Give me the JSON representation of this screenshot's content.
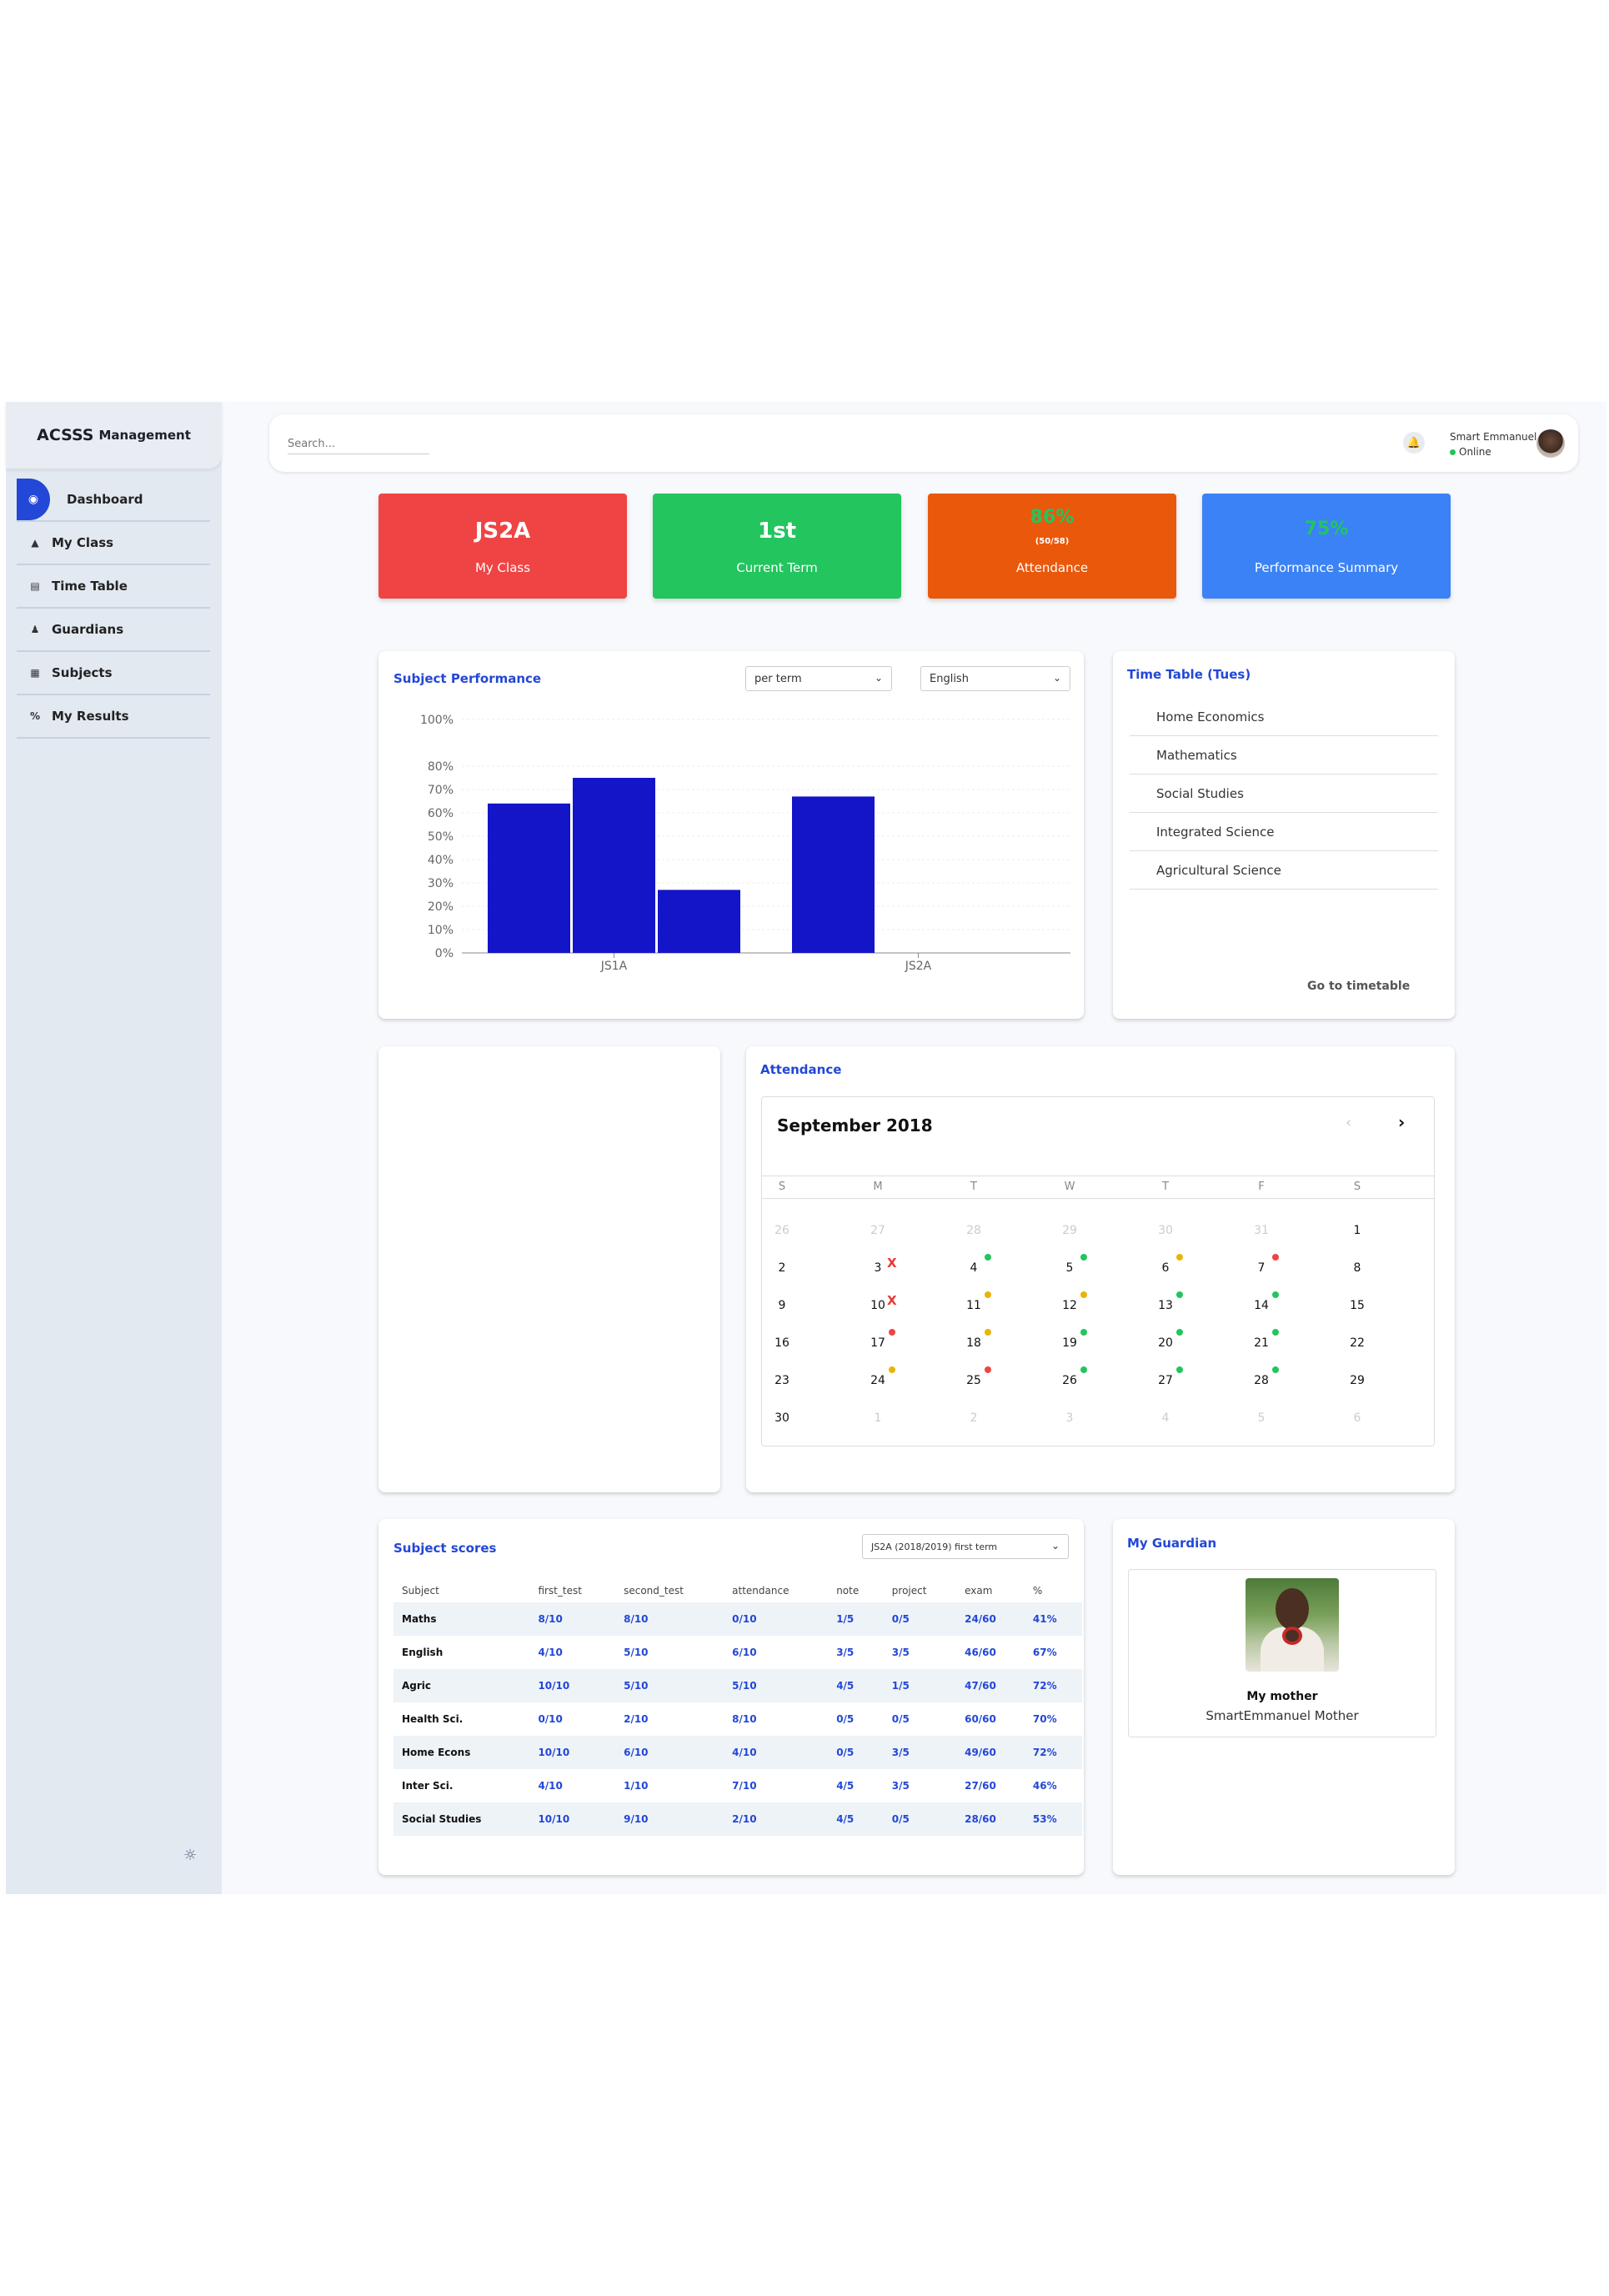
{
  "brand": {
    "name": "ACSSS",
    "suffix": "Management"
  },
  "sidebar": {
    "items": [
      {
        "label": "Dashboard",
        "icon": "dashboard-icon"
      },
      {
        "label": "My Class",
        "icon": "home-icon"
      },
      {
        "label": "Time Table",
        "icon": "table-icon"
      },
      {
        "label": "Guardians",
        "icon": "people-icon"
      },
      {
        "label": "Subjects",
        "icon": "book-icon"
      },
      {
        "label": "My Results",
        "icon": "percent-icon"
      }
    ],
    "theme_toggle_icon": "sun-icon"
  },
  "header": {
    "search_placeholder": "Search...",
    "user_name": "Smart Emmanuel",
    "user_status": "Online"
  },
  "stats": [
    {
      "value": "JS2A",
      "label": "My Class",
      "color": "#ef4444"
    },
    {
      "value": "1st",
      "label": "Current Term",
      "color": "#22c55e"
    },
    {
      "value": "86%",
      "detail": "(50/58)",
      "label": "Attendance",
      "color": "#ea580c"
    },
    {
      "value": "75%",
      "label": "Performance Summary",
      "color": "#3b82f6"
    }
  ],
  "subject_performance": {
    "title": "Subject Performance",
    "period_select": "per term",
    "subject_select": "English"
  },
  "chart_data": {
    "type": "bar",
    "categories": [
      "JS1A",
      "JS2A"
    ],
    "series": [
      {
        "values": [
          64,
          67
        ]
      },
      {
        "values": [
          75,
          null
        ]
      },
      {
        "values": [
          27,
          null
        ]
      }
    ],
    "y_ticks": [
      "0%",
      "10%",
      "20%",
      "30%",
      "40%",
      "50%",
      "60%",
      "70%",
      "80%",
      "100%"
    ],
    "ylim": [
      0,
      100
    ],
    "bar_color": "#1414c8"
  },
  "timetable": {
    "title": "Time Table (Tues)",
    "items": [
      "Home Economics",
      "Mathematics",
      "Social Studies",
      "Integrated Science",
      "Agricultural Science"
    ],
    "link": "Go to timetable"
  },
  "attendance": {
    "title": "Attendance",
    "month": "September 2018",
    "days_of_week": [
      "S",
      "M",
      "T",
      "W",
      "T",
      "F",
      "S"
    ],
    "weeks": [
      [
        {
          "d": "26",
          "muted": true
        },
        {
          "d": "27",
          "muted": true
        },
        {
          "d": "28",
          "muted": true
        },
        {
          "d": "29",
          "muted": true
        },
        {
          "d": "30",
          "muted": true
        },
        {
          "d": "31",
          "muted": true
        },
        {
          "d": "1"
        }
      ],
      [
        {
          "d": "2"
        },
        {
          "d": "3",
          "mark": "x"
        },
        {
          "d": "4",
          "mark": "green"
        },
        {
          "d": "5",
          "mark": "green"
        },
        {
          "d": "6",
          "mark": "yellow"
        },
        {
          "d": "7",
          "mark": "red"
        },
        {
          "d": "8"
        }
      ],
      [
        {
          "d": "9"
        },
        {
          "d": "10",
          "mark": "x"
        },
        {
          "d": "11",
          "mark": "yellow"
        },
        {
          "d": "12",
          "mark": "yellow"
        },
        {
          "d": "13",
          "mark": "green"
        },
        {
          "d": "14",
          "mark": "green"
        },
        {
          "d": "15"
        }
      ],
      [
        {
          "d": "16"
        },
        {
          "d": "17",
          "mark": "red"
        },
        {
          "d": "18",
          "mark": "yellow"
        },
        {
          "d": "19",
          "mark": "green"
        },
        {
          "d": "20",
          "mark": "green"
        },
        {
          "d": "21",
          "mark": "green"
        },
        {
          "d": "22"
        }
      ],
      [
        {
          "d": "23"
        },
        {
          "d": "24",
          "mark": "yellow"
        },
        {
          "d": "25",
          "mark": "red"
        },
        {
          "d": "26",
          "mark": "green"
        },
        {
          "d": "27",
          "mark": "green"
        },
        {
          "d": "28",
          "mark": "green"
        },
        {
          "d": "29"
        }
      ],
      [
        {
          "d": "30"
        },
        {
          "d": "1",
          "muted": true
        },
        {
          "d": "2",
          "muted": true
        },
        {
          "d": "3",
          "muted": true
        },
        {
          "d": "4",
          "muted": true
        },
        {
          "d": "5",
          "muted": true
        },
        {
          "d": "6",
          "muted": true
        }
      ]
    ],
    "mark_colors": {
      "green": "#22c55e",
      "yellow": "#eab308",
      "red": "#ef4444",
      "x": "#e53935"
    }
  },
  "scores": {
    "title": "Subject scores",
    "term_select": "JS2A (2018/2019) first term",
    "columns": [
      "Subject",
      "first_test",
      "second_test",
      "attendance",
      "note",
      "project",
      "exam",
      "%"
    ],
    "rows": [
      [
        "Maths",
        "8/10",
        "8/10",
        "0/10",
        "1/5",
        "0/5",
        "24/60",
        "41%"
      ],
      [
        "English",
        "4/10",
        "5/10",
        "6/10",
        "3/5",
        "3/5",
        "46/60",
        "67%"
      ],
      [
        "Agric",
        "10/10",
        "5/10",
        "5/10",
        "4/5",
        "1/5",
        "47/60",
        "72%"
      ],
      [
        "Health Sci.",
        "0/10",
        "2/10",
        "8/10",
        "0/5",
        "0/5",
        "60/60",
        "70%"
      ],
      [
        "Home Econs",
        "10/10",
        "6/10",
        "4/10",
        "0/5",
        "3/5",
        "49/60",
        "72%"
      ],
      [
        "Inter Sci.",
        "4/10",
        "1/10",
        "7/10",
        "4/5",
        "3/5",
        "27/60",
        "46%"
      ],
      [
        "Social Studies",
        "10/10",
        "9/10",
        "2/10",
        "4/5",
        "0/5",
        "28/60",
        "53%"
      ]
    ]
  },
  "guardian": {
    "title": "My Guardian",
    "relation": "My mother",
    "name": "SmartEmmanuel Mother"
  }
}
